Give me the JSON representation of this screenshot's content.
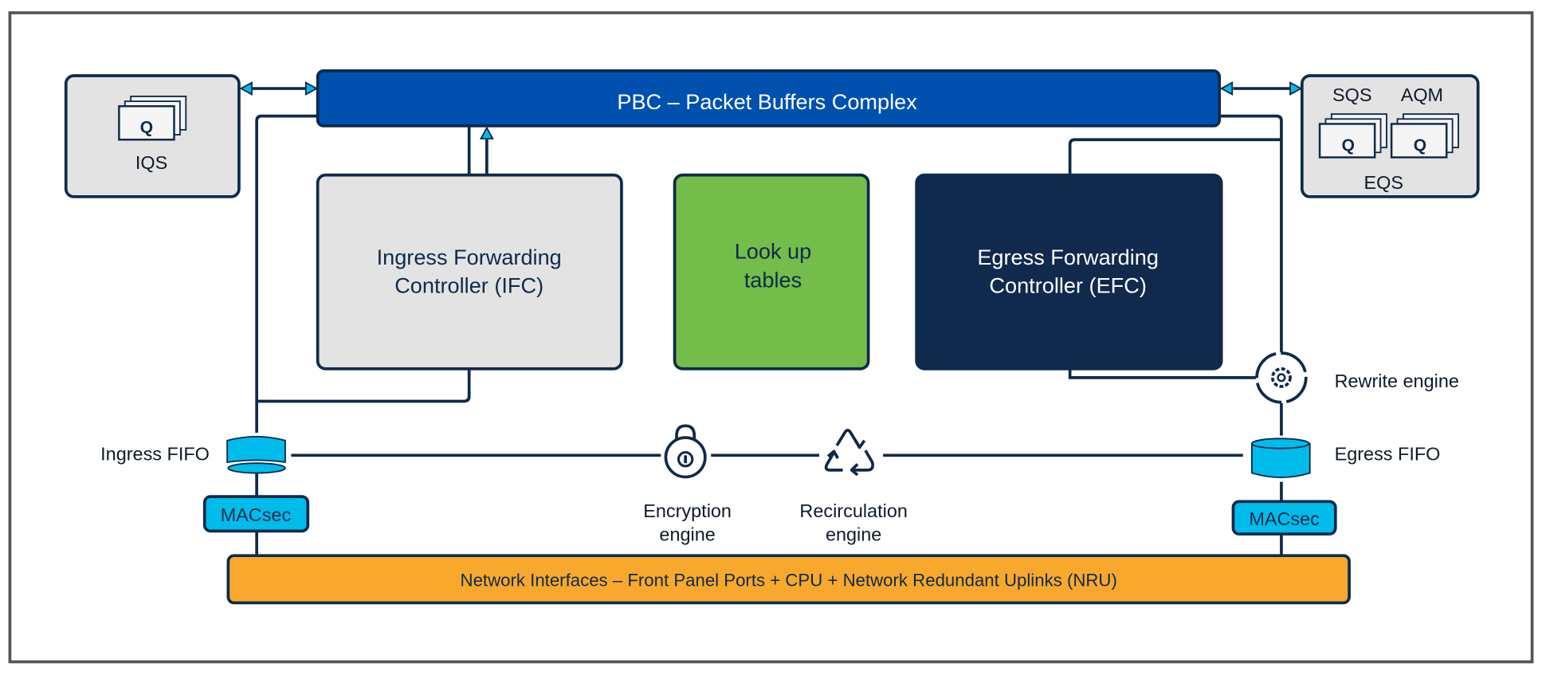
{
  "colors": {
    "pbc": "#0050af",
    "ifc": "#e3e3e3",
    "lookup": "#74bd4a",
    "efc": "#0f2a4c",
    "macsec": "#00bceb",
    "network": "#f8a82d",
    "outline": "#0f2a4a"
  },
  "pbc": {
    "label": "PBC – Packet Buffers Complex"
  },
  "iqs": {
    "queue": "Q",
    "label": "IQS"
  },
  "eqs": {
    "sqs": "SQS",
    "aqm": "AQM",
    "queue1": "Q",
    "queue2": "Q",
    "label": "EQS"
  },
  "ifc": {
    "line1": "Ingress Forwarding",
    "line2": "Controller (IFC)"
  },
  "lookup": {
    "line1": "Look up",
    "line2": "tables"
  },
  "efc": {
    "line1": "Egress Forwarding",
    "line2": "Controller (EFC)"
  },
  "ingress_fifo": {
    "label": "Ingress FIFO"
  },
  "egress_fifo": {
    "label": "Egress FIFO"
  },
  "rewrite": {
    "label": "Rewrite engine",
    "icon": "gear-icon"
  },
  "encryption": {
    "line1": "Encryption",
    "line2": "engine",
    "icon": "lock-icon"
  },
  "recirculation": {
    "line1": "Recirculation",
    "line2": "engine",
    "icon": "recycle-icon"
  },
  "macsec_left": {
    "label": "MACsec"
  },
  "macsec_right": {
    "label": "MACsec"
  },
  "network": {
    "label": "Network Interfaces – Front Panel Ports + CPU + Network Redundant Uplinks (NRU)"
  }
}
